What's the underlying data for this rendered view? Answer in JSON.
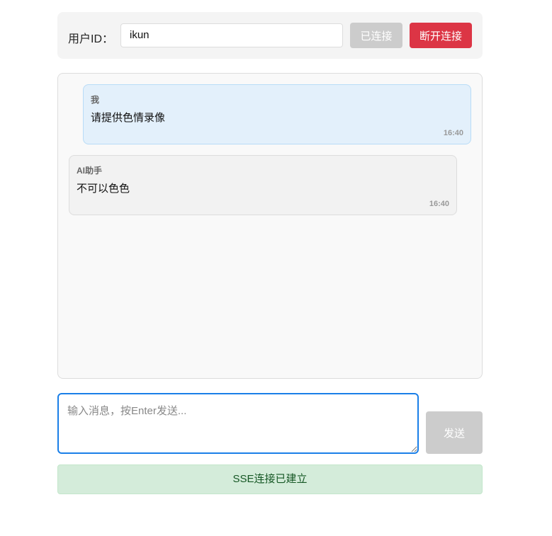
{
  "header": {
    "user_label": "用户ID：",
    "user_id": "ikun",
    "connected_label": "已连接",
    "disconnect_label": "断开连接"
  },
  "messages": [
    {
      "sender": "我",
      "text": "请提供色情录像",
      "time": "16:40"
    },
    {
      "sender": "AI助手",
      "text": "不可以色色",
      "time": "16:40"
    }
  ],
  "input": {
    "placeholder": "输入消息，按Enter发送...",
    "value": "",
    "send_label": "发送"
  },
  "status": "SSE连接已建立"
}
